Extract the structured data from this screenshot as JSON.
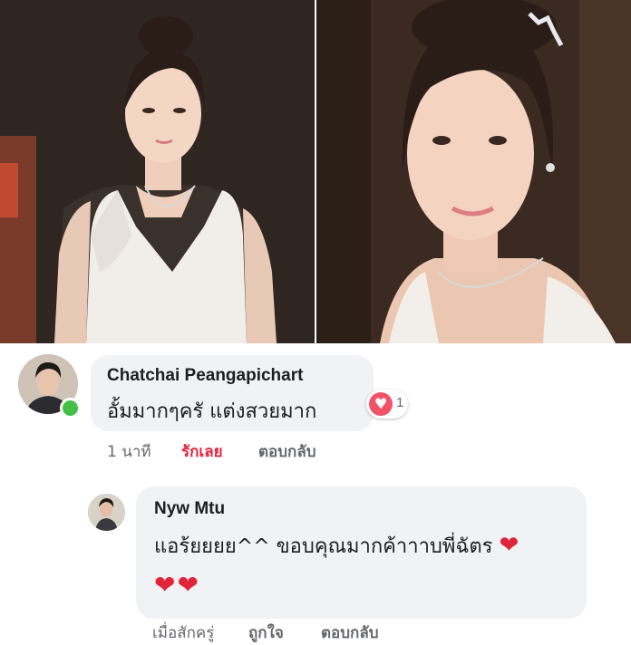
{
  "photos": [
    {
      "id": "left",
      "icon": "bride-photo-full"
    },
    {
      "id": "right",
      "icon": "bride-photo-closeup"
    }
  ],
  "comments": [
    {
      "author": "Chatchai Peangapichart",
      "text": "อั้มมากๆครั แต่งสวยมาก",
      "reaction": {
        "icon": "heart-reaction-icon",
        "count": "1"
      },
      "actions": {
        "time": "1 นาที",
        "like": "รักเลย",
        "reply": "ตอบกลับ"
      },
      "online": true
    },
    {
      "author": "Nyw Mtu",
      "text": "แอร้ยยยย^^ ขอบคุณมากค้าาาบพี่ฉัตร",
      "emoji": "❤",
      "emoji_line": "❤❤",
      "actions": {
        "time": "เมื่อสักครู่",
        "like": "ถูกใจ",
        "reply": "ตอบกลับ"
      }
    }
  ],
  "colors": {
    "accent_like": "#e0243a",
    "bubble": "#f0f2f5",
    "online": "#43c045"
  }
}
